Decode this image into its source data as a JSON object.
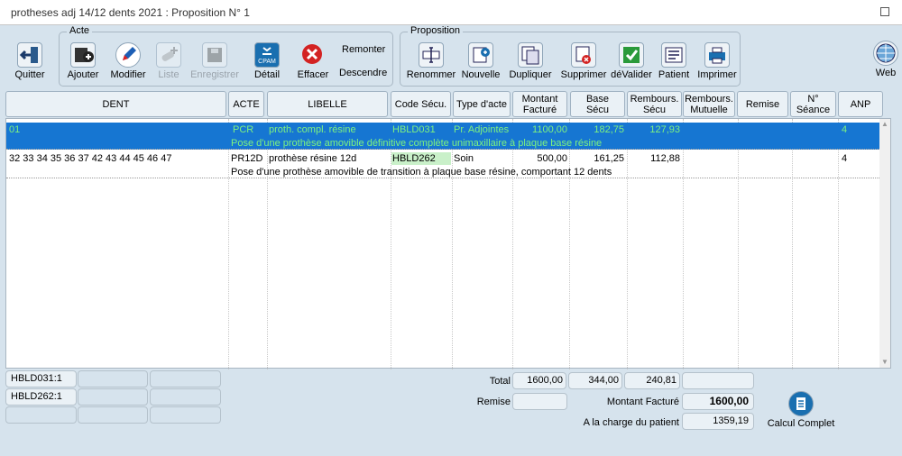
{
  "window": {
    "title": "protheses adj 14/12 dents 2021 : Proposition N° 1"
  },
  "toolbar": {
    "quit": "Quitter",
    "acte_group": "Acte",
    "ajouter": "Ajouter",
    "modifier": "Modifier",
    "liste": "Liste",
    "enregistrer": "Enregistrer",
    "detail": "Détail",
    "effacer": "Effacer",
    "remonter": "Remonter",
    "descendre": "Descendre",
    "proposition_group": "Proposition",
    "renommer": "Renommer",
    "nouvelle": "Nouvelle",
    "dupliquer": "Dupliquer",
    "supprimer": "Supprimer",
    "devalider": "déValider",
    "patient": "Patient",
    "imprimer": "Imprimer",
    "web": "Web",
    "cpam_badge": "CPAM"
  },
  "columns": [
    "DENT",
    "ACTE",
    "LIBELLE",
    "Code Sécu.",
    "Type d'acte",
    "Montant Facturé",
    "Base Sécu",
    "Rembours. Sécu",
    "Rembours. Mutuelle",
    "Remise",
    "N° Séance",
    "ANP"
  ],
  "rows": [
    {
      "dent": "01",
      "acte": "PCR",
      "libelle": "proth. compl. résine",
      "code": "HBLD031",
      "type": "Pr. Adjointes",
      "montant": "1100,00",
      "base": "182,75",
      "rembours": "127,93",
      "mutuelle": "",
      "remise": "",
      "seance": "",
      "anp": "4",
      "description": "Pose d'une prothèse amovible définitive complète unimaxillaire à plaque base résine"
    },
    {
      "dent": "32 33 34 35 36 37 42 43 44 45 46 47",
      "acte": "PR12D",
      "libelle": "prothèse résine 12d",
      "code": "HBLD262",
      "type": "Soin",
      "montant": "500,00",
      "base": "161,25",
      "rembours": "112,88",
      "mutuelle": "",
      "remise": "",
      "seance": "",
      "anp": "4",
      "description": "Pose d'une prothèse amovible de transition à plaque base résine, comportant 12 dents"
    }
  ],
  "codes_summary": [
    "HBLD031:1",
    "HBLD262:1"
  ],
  "totals": {
    "total_label": "Total",
    "total_montant": "1600,00",
    "total_base": "344,00",
    "total_rembours": "240,81",
    "remise_label": "Remise",
    "montant_facture_label": "Montant Facturé",
    "montant_facture": "1600,00",
    "charge_patient_label": "A la charge du patient",
    "charge_patient": "1359,19"
  },
  "calcul_complet": "Calcul Complet"
}
